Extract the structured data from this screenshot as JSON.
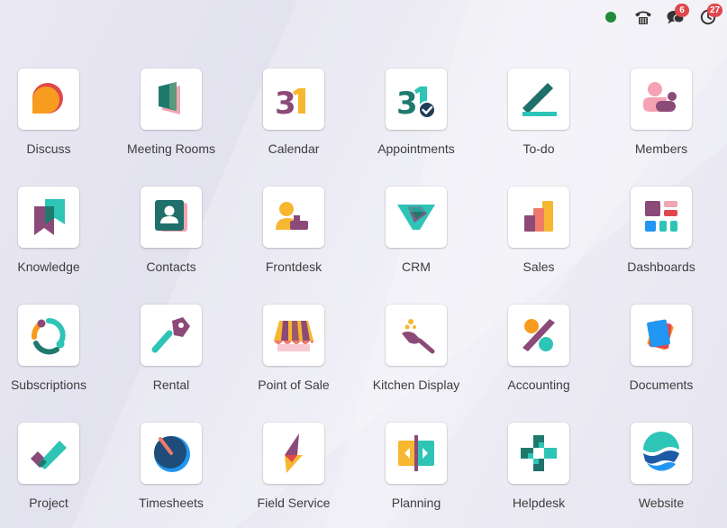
{
  "systray": {
    "presence_color": "#1e8a3a",
    "messages_count": "6",
    "activities_count": "27",
    "icons": [
      "presence-dot",
      "phone-icon",
      "chat-icon",
      "clock-icon"
    ]
  },
  "apps": [
    {
      "label": "Discuss",
      "icon": "discuss-icon"
    },
    {
      "label": "Meeting Rooms",
      "icon": "meeting-rooms-icon"
    },
    {
      "label": "Calendar",
      "icon": "calendar-icon"
    },
    {
      "label": "Appointments",
      "icon": "appointments-icon"
    },
    {
      "label": "To-do",
      "icon": "todo-icon"
    },
    {
      "label": "Members",
      "icon": "members-icon"
    },
    {
      "label": "Knowledge",
      "icon": "knowledge-icon"
    },
    {
      "label": "Contacts",
      "icon": "contacts-icon"
    },
    {
      "label": "Frontdesk",
      "icon": "frontdesk-icon"
    },
    {
      "label": "CRM",
      "icon": "crm-icon"
    },
    {
      "label": "Sales",
      "icon": "sales-icon"
    },
    {
      "label": "Dashboards",
      "icon": "dashboards-icon"
    },
    {
      "label": "Subscriptions",
      "icon": "subscriptions-icon"
    },
    {
      "label": "Rental",
      "icon": "rental-icon"
    },
    {
      "label": "Point of Sale",
      "icon": "point-of-sale-icon"
    },
    {
      "label": "Kitchen Display",
      "icon": "kitchen-display-icon"
    },
    {
      "label": "Accounting",
      "icon": "accounting-icon"
    },
    {
      "label": "Documents",
      "icon": "documents-icon"
    },
    {
      "label": "Project",
      "icon": "project-icon"
    },
    {
      "label": "Timesheets",
      "icon": "timesheets-icon"
    },
    {
      "label": "Field Service",
      "icon": "field-service-icon"
    },
    {
      "label": "Planning",
      "icon": "planning-icon"
    },
    {
      "label": "Helpdesk",
      "icon": "helpdesk-icon"
    },
    {
      "label": "Website",
      "icon": "website-icon"
    }
  ],
  "calendar_day": "31"
}
